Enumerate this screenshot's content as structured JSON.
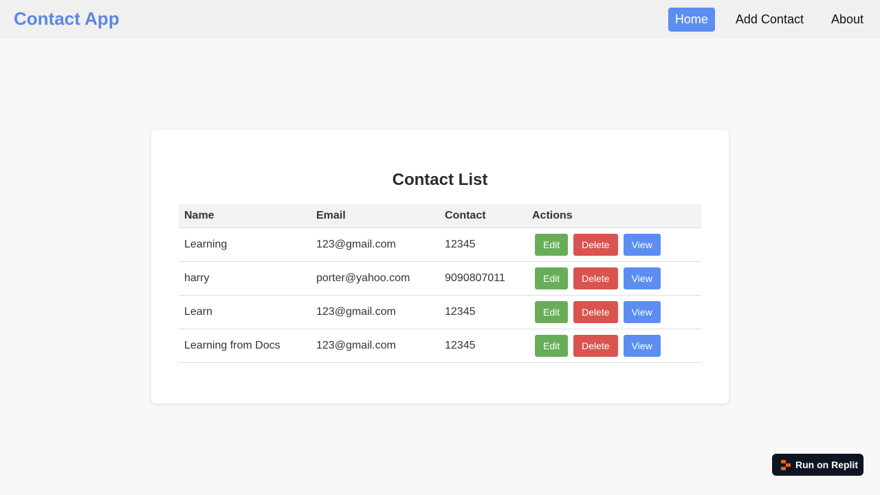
{
  "header": {
    "brand": "Contact App",
    "nav": [
      {
        "label": "Home",
        "active": true
      },
      {
        "label": "Add Contact",
        "active": false
      },
      {
        "label": "About",
        "active": false
      }
    ]
  },
  "main": {
    "title": "Contact List",
    "columns": [
      "Name",
      "Email",
      "Contact",
      "Actions"
    ],
    "rows": [
      {
        "name": "Learning",
        "email": "123@gmail.com",
        "contact": "12345"
      },
      {
        "name": "harry",
        "email": "porter@yahoo.com",
        "contact": "9090807011"
      },
      {
        "name": "Learn",
        "email": "123@gmail.com",
        "contact": "12345"
      },
      {
        "name": "Learning from Docs",
        "email": "123@gmail.com",
        "contact": "12345"
      }
    ],
    "actions": {
      "edit_label": "Edit",
      "delete_label": "Delete",
      "view_label": "View"
    }
  },
  "badge": {
    "label": "Run on Replit",
    "icon": "replit-logo-icon"
  },
  "colors": {
    "brand": "#5b87e1",
    "primary": "#5b8ef0",
    "edit": "#69ac5a",
    "delete": "#d9534f",
    "badge_bg": "#0e1525",
    "badge_accent": "#f26207"
  }
}
